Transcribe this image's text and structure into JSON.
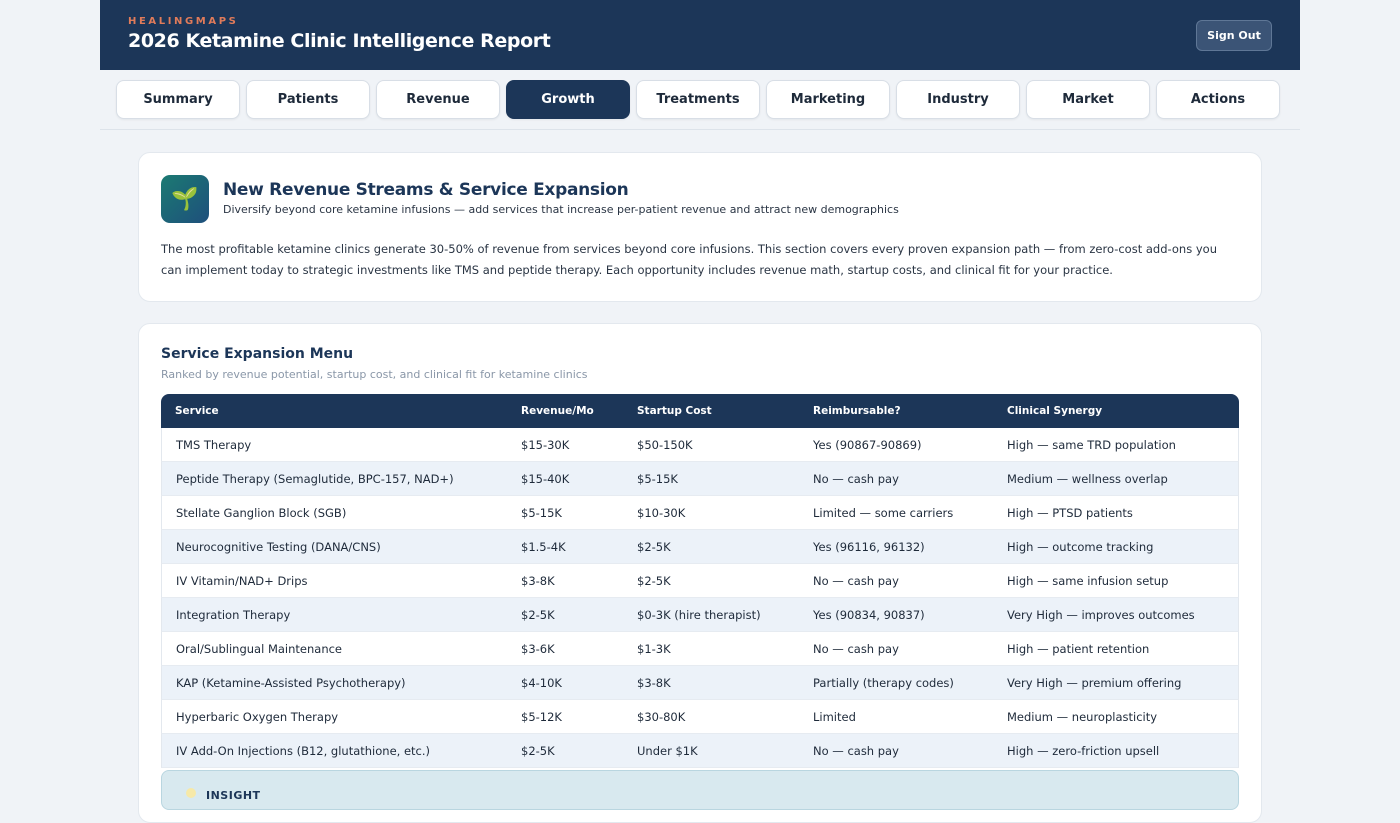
{
  "header": {
    "brand": "HEALINGMAPS",
    "title": "2026 Ketamine Clinic Intelligence Report",
    "sign_out": "Sign Out"
  },
  "tabs": [
    {
      "label": "Summary",
      "active": false
    },
    {
      "label": "Patients",
      "active": false
    },
    {
      "label": "Revenue",
      "active": false
    },
    {
      "label": "Growth",
      "active": true
    },
    {
      "label": "Treatments",
      "active": false
    },
    {
      "label": "Marketing",
      "active": false
    },
    {
      "label": "Industry",
      "active": false
    },
    {
      "label": "Market",
      "active": false
    },
    {
      "label": "Actions",
      "active": false
    }
  ],
  "intro": {
    "icon": "seedling-icon",
    "title": "New Revenue Streams & Service Expansion",
    "subtitle": "Diversify beyond core ketamine infusions — add services that increase per-patient revenue and attract new demographics",
    "body": "The most profitable ketamine clinics generate 30-50% of revenue from services beyond core infusions. This section covers every proven expansion path — from zero-cost add-ons you can implement today to strategic investments like TMS and peptide therapy. Each opportunity includes revenue math, startup costs, and clinical fit for your practice."
  },
  "menu": {
    "title": "Service Expansion Menu",
    "subtitle": "Ranked by revenue potential, startup cost, and clinical fit for ketamine clinics",
    "columns": [
      "Service",
      "Revenue/Mo",
      "Startup Cost",
      "Reimbursable?",
      "Clinical Synergy"
    ],
    "rows": [
      [
        "TMS Therapy",
        "$15-30K",
        "$50-150K",
        "Yes (90867-90869)",
        "High — same TRD population"
      ],
      [
        "Peptide Therapy (Semaglutide, BPC-157, NAD+)",
        "$15-40K",
        "$5-15K",
        "No — cash pay",
        "Medium — wellness overlap"
      ],
      [
        "Stellate Ganglion Block (SGB)",
        "$5-15K",
        "$10-30K",
        "Limited — some carriers",
        "High — PTSD patients"
      ],
      [
        "Neurocognitive Testing (DANA/CNS)",
        "$1.5-4K",
        "$2-5K",
        "Yes (96116, 96132)",
        "High — outcome tracking"
      ],
      [
        "IV Vitamin/NAD+ Drips",
        "$3-8K",
        "$2-5K",
        "No — cash pay",
        "High — same infusion setup"
      ],
      [
        "Integration Therapy",
        "$2-5K",
        "$0-3K (hire therapist)",
        "Yes (90834, 90837)",
        "Very High — improves outcomes"
      ],
      [
        "Oral/Sublingual Maintenance",
        "$3-6K",
        "$1-3K",
        "No — cash pay",
        "High — patient retention"
      ],
      [
        "KAP (Ketamine-Assisted Psychotherapy)",
        "$4-10K",
        "$3-8K",
        "Partially (therapy codes)",
        "Very High — premium offering"
      ],
      [
        "Hyperbaric Oxygen Therapy",
        "$5-12K",
        "$30-80K",
        "Limited",
        "Medium — neuroplasticity"
      ],
      [
        "IV Add-On Injections (B12, glutathione, etc.)",
        "$2-5K",
        "Under $1K",
        "No — cash pay",
        "High — zero-friction upsell"
      ]
    ]
  },
  "insight": {
    "icon": "lightbulb-icon",
    "label": "INSIGHT"
  }
}
